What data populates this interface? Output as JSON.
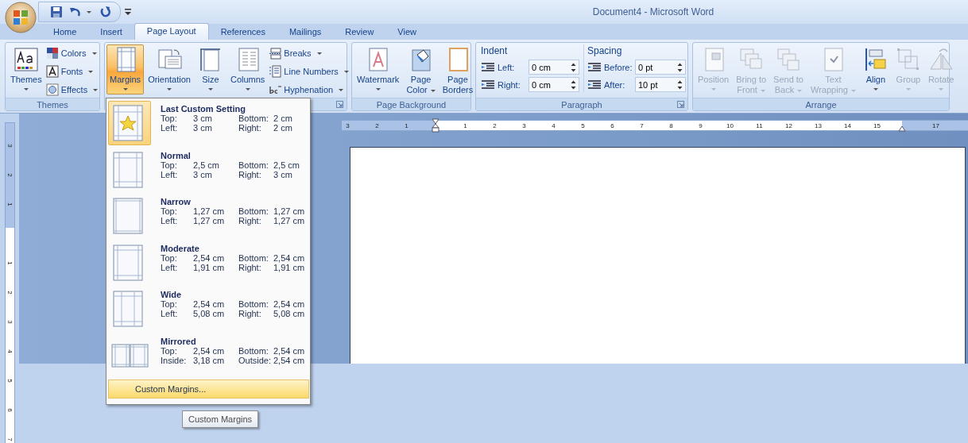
{
  "window": {
    "title": "Document4 - Microsoft Word"
  },
  "tabs": [
    {
      "label": "Home",
      "selected": false
    },
    {
      "label": "Insert",
      "selected": false
    },
    {
      "label": "Page Layout",
      "selected": true
    },
    {
      "label": "References",
      "selected": false
    },
    {
      "label": "Mailings",
      "selected": false
    },
    {
      "label": "Review",
      "selected": false
    },
    {
      "label": "View",
      "selected": false
    }
  ],
  "ribbon_groups": [
    {
      "label": "Themes",
      "launcher": false,
      "items": [
        {
          "kind": "large",
          "label": "Themes",
          "dropdown": true
        },
        {
          "kind": "small",
          "label": "Colors",
          "dropdown": true
        },
        {
          "kind": "small",
          "label": "Fonts",
          "dropdown": true
        },
        {
          "kind": "small",
          "label": "Effects",
          "dropdown": true
        }
      ]
    },
    {
      "launcher": true,
      "items": [
        {
          "kind": "large",
          "label": "Margins",
          "dropdown": true,
          "pressed": true
        },
        {
          "kind": "large",
          "label": "Orientation",
          "dropdown": true,
          "pressed": false
        },
        {
          "kind": "large",
          "label": "Size",
          "dropdown": true,
          "pressed": false
        },
        {
          "kind": "large",
          "label": "Columns",
          "dropdown": true,
          "pressed": false
        },
        {
          "kind": "small",
          "label": "Breaks",
          "dropdown": true
        },
        {
          "kind": "small",
          "label": "Line Numbers",
          "dropdown": true
        },
        {
          "kind": "small",
          "label": "Hyphenation",
          "dropdown": true
        }
      ]
    },
    {
      "label": "Page Background",
      "launcher": false,
      "items": [
        {
          "kind": "large",
          "label": "Watermark",
          "dropdown": true
        },
        {
          "kind": "large",
          "label": "Page\nColor",
          "dropdown": true
        },
        {
          "kind": "large",
          "label": "Page\nBorders",
          "dropdown": false
        }
      ]
    },
    {
      "label": "Paragraph",
      "launcher": true,
      "items": [
        {
          "kind": "heading",
          "label": "Indent"
        },
        {
          "kind": "spinner",
          "label": "Left:",
          "value": "0 cm"
        },
        {
          "kind": "spinner",
          "label": "Right:",
          "value": "0 cm"
        },
        {
          "kind": "heading",
          "label": "Spacing"
        },
        {
          "kind": "spinner",
          "label": "Before:",
          "value": "0 pt"
        },
        {
          "kind": "spinner",
          "label": "After:",
          "value": "10 pt"
        }
      ]
    },
    {
      "label": "Arrange",
      "launcher": false,
      "items": [
        {
          "kind": "large",
          "label": "Position",
          "dropdown": true,
          "disabled": true
        },
        {
          "kind": "large",
          "label": "Bring to\nFront",
          "dropdown": true,
          "disabled": true
        },
        {
          "kind": "large",
          "label": "Send to\nBack",
          "dropdown": true,
          "disabled": true
        },
        {
          "kind": "large",
          "label": "Text\nWrapping",
          "dropdown": true,
          "disabled": true
        },
        {
          "kind": "large",
          "label": "Align",
          "dropdown": true,
          "disabled": false
        },
        {
          "kind": "large",
          "label": "Group",
          "dropdown": true,
          "disabled": true
        },
        {
          "kind": "large",
          "label": "Rotate",
          "dropdown": true,
          "disabled": true
        }
      ]
    }
  ],
  "horizontal_ruler": {
    "before_origin": [
      "3",
      "2",
      "1"
    ],
    "after_origin": [
      "1",
      "2",
      "3",
      "4",
      "5",
      "6",
      "7",
      "8",
      "9",
      "10",
      "11",
      "12",
      "13",
      "14",
      "15"
    ],
    "after_right_indent": [
      "17"
    ]
  },
  "vertical_ruler": {
    "before_origin": [
      "3",
      "2",
      "1"
    ],
    "after_origin": [
      "1",
      "2",
      "3",
      "4",
      "5",
      "6",
      "7"
    ]
  },
  "margins_menu": {
    "items": [
      {
        "kind": "custom",
        "name": "Last Custom Setting",
        "selected": true,
        "rows": [
          [
            "Top:",
            "3 cm",
            "Bottom:",
            "2 cm"
          ],
          [
            "Left:",
            "3 cm",
            "Right:",
            "2 cm"
          ]
        ]
      },
      {
        "kind": "normal",
        "name": "Normal",
        "selected": false,
        "rows": [
          [
            "Top:",
            "2,5 cm",
            "Bottom:",
            "2,5 cm"
          ],
          [
            "Left:",
            "3 cm",
            "Right:",
            "3 cm"
          ]
        ]
      },
      {
        "kind": "narrow",
        "name": "Narrow",
        "selected": false,
        "rows": [
          [
            "Top:",
            "1,27 cm",
            "Bottom:",
            "1,27 cm"
          ],
          [
            "Left:",
            "1,27 cm",
            "Right:",
            "1,27 cm"
          ]
        ]
      },
      {
        "kind": "moderate",
        "name": "Moderate",
        "selected": false,
        "rows": [
          [
            "Top:",
            "2,54 cm",
            "Bottom:",
            "2,54 cm"
          ],
          [
            "Left:",
            "1,91 cm",
            "Right:",
            "1,91 cm"
          ]
        ]
      },
      {
        "kind": "wide",
        "name": "Wide",
        "selected": false,
        "rows": [
          [
            "Top:",
            "2,54 cm",
            "Bottom:",
            "2,54 cm"
          ],
          [
            "Left:",
            "5,08 cm",
            "Right:",
            "5,08 cm"
          ]
        ]
      },
      {
        "kind": "mirrored",
        "name": "Mirrored",
        "selected": false,
        "rows": [
          [
            "Top:",
            "2,54 cm",
            "Bottom:",
            "2,54 cm"
          ],
          [
            "Inside:",
            "3,18 cm",
            "Outside:",
            "2,54 cm"
          ]
        ]
      }
    ],
    "footer": {
      "label": "Custom Margins...",
      "highlighted": true
    }
  },
  "tooltip": "Custom Margins"
}
